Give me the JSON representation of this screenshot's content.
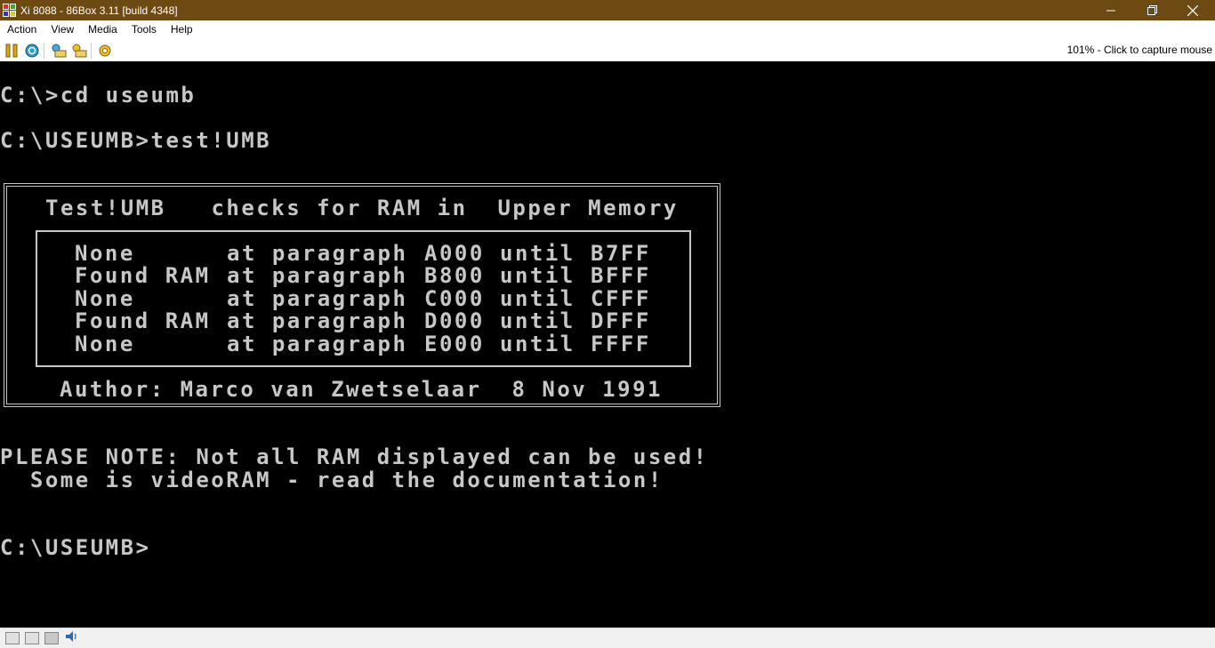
{
  "window": {
    "title": "Xi 8088 - 86Box 3.11 [build 4348]",
    "controls": [
      "minimize",
      "restore",
      "close"
    ]
  },
  "menubar": {
    "items": [
      "Action",
      "View",
      "Media",
      "Tools",
      "Help"
    ]
  },
  "toolbar": {
    "buttons": [
      "pause-icon",
      "reset-icon",
      "ctrl-alt-del-icon",
      "ctrl-alt-esc-icon",
      "settings-icon"
    ],
    "capture_hint": "101% - Click to capture mouse"
  },
  "screen": {
    "line1": "C:\\>cd useumb",
    "line2": "C:\\USEUMB>test!UMB",
    "box_title": "Test!UMB   checks for RAM in  Upper Memory",
    "rows": [
      {
        "status": "None     ",
        "at": "at paragraph",
        "from": "A000",
        "until": "until",
        "to": "B7FF"
      },
      {
        "status": "Found RAM",
        "at": "at paragraph",
        "from": "B800",
        "until": "until",
        "to": "BFFF"
      },
      {
        "status": "None     ",
        "at": "at paragraph",
        "from": "C000",
        "until": "until",
        "to": "CFFF"
      },
      {
        "status": "Found RAM",
        "at": "at paragraph",
        "from": "D000",
        "until": "until",
        "to": "DFFF"
      },
      {
        "status": "None     ",
        "at": "at paragraph",
        "from": "E000",
        "until": "until",
        "to": "FFFF"
      }
    ],
    "author": "Author: Marco van Zwetselaar  8 Nov 1991",
    "note1": "PLEASE NOTE: Not all RAM displayed can be used!",
    "note2": "  Some is videoRAM - read the documentation!",
    "prompt": "C:\\USEUMB>",
    "text_color": "#c7c7c7"
  },
  "statusbar": {
    "icons": [
      "floppy-icon",
      "floppy-2-icon",
      "hard-disk-icon",
      "sound-icon"
    ]
  },
  "colors": {
    "titlebar": "#6e4a13",
    "screen_bg": "#000000"
  }
}
